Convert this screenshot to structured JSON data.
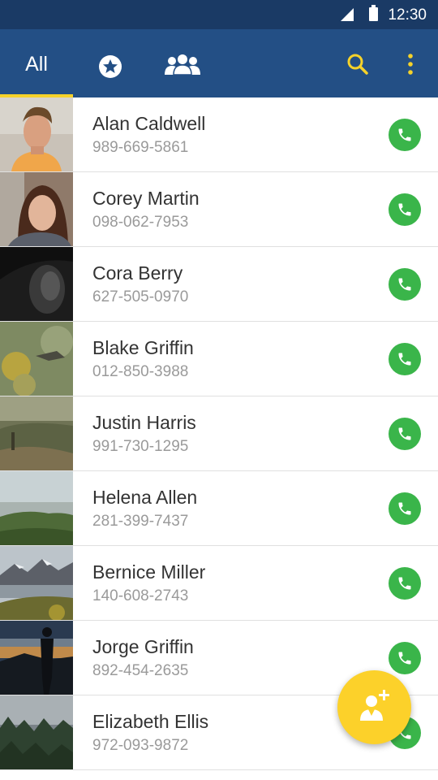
{
  "status_bar": {
    "time": "12:30",
    "icons": [
      "signal-icon",
      "battery-icon"
    ]
  },
  "toolbar": {
    "tabs": [
      {
        "label": "All",
        "selected": true
      },
      {
        "icon": "star-icon",
        "selected": false
      },
      {
        "icon": "groups-icon",
        "selected": false
      }
    ],
    "actions": [
      "search-icon",
      "overflow-menu-icon"
    ]
  },
  "colors": {
    "toolbar": "#234f85",
    "status_bar": "#1a3a65",
    "accent": "#f5d22a",
    "call": "#3ab54a",
    "fab": "#fcd12a"
  },
  "contacts": [
    {
      "name": "Alan Caldwell",
      "phone": "989-669-5861"
    },
    {
      "name": "Corey Martin",
      "phone": "098-062-7953"
    },
    {
      "name": "Cora Berry",
      "phone": "627-505-0970"
    },
    {
      "name": "Blake Griffin",
      "phone": "012-850-3988"
    },
    {
      "name": "Justin Harris",
      "phone": "991-730-1295"
    },
    {
      "name": "Helena Allen",
      "phone": "281-399-7437"
    },
    {
      "name": "Bernice Miller",
      "phone": "140-608-2743"
    },
    {
      "name": "Jorge Griffin",
      "phone": "892-454-2635"
    },
    {
      "name": "Elizabeth Ellis",
      "phone": "972-093-9872"
    }
  ],
  "fab": {
    "icon": "add-contact-icon"
  }
}
